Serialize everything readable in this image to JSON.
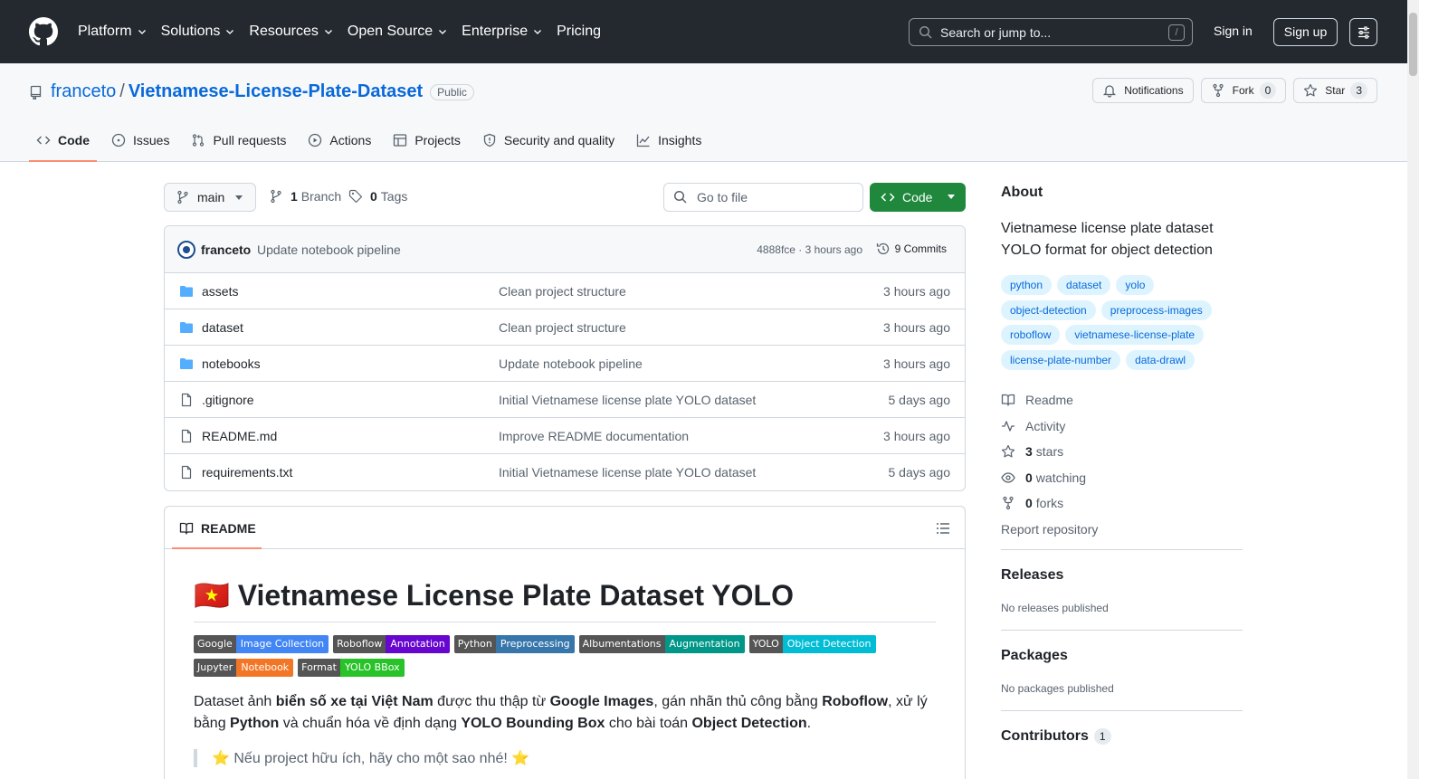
{
  "header": {
    "nav": [
      "Platform",
      "Solutions",
      "Resources",
      "Open Source",
      "Enterprise",
      "Pricing"
    ],
    "search_placeholder": "Search or jump to...",
    "search_shortcut": "/",
    "sign_in": "Sign in",
    "sign_up": "Sign up"
  },
  "repo": {
    "owner": "franceto",
    "separator": "/",
    "name": "Vietnamese-License-Plate-Dataset",
    "visibility": "Public",
    "notifications_label": "Notifications",
    "fork_label": "Fork",
    "fork_count": "0",
    "star_label": "Star",
    "star_count": "3",
    "tabs": [
      "Code",
      "Issues",
      "Pull requests",
      "Actions",
      "Projects",
      "Security and quality",
      "Insights"
    ]
  },
  "toolbar": {
    "branch": "main",
    "branches_count": "1",
    "branches_label": "Branch",
    "tags_count": "0",
    "tags_label": "Tags",
    "goto_placeholder": "Go to file",
    "code_button": "Code"
  },
  "commit": {
    "author": "franceto",
    "message": "Update notebook pipeline",
    "sha_time": "4888fce · 3 hours ago",
    "commits_label": "9 Commits"
  },
  "files": [
    {
      "name": "assets",
      "type": "folder",
      "message": "Clean project structure",
      "age": "3 hours ago"
    },
    {
      "name": "dataset",
      "type": "folder",
      "message": "Clean project structure",
      "age": "3 hours ago"
    },
    {
      "name": "notebooks",
      "type": "folder",
      "message": "Update notebook pipeline",
      "age": "3 hours ago"
    },
    {
      "name": ".gitignore",
      "type": "file",
      "message": "Initial Vietnamese license plate YOLO dataset",
      "age": "5 days ago"
    },
    {
      "name": "README.md",
      "type": "file",
      "message": "Improve README documentation",
      "age": "3 hours ago"
    },
    {
      "name": "requirements.txt",
      "type": "file",
      "message": "Initial Vietnamese license plate YOLO dataset",
      "age": "5 days ago"
    }
  ],
  "readme": {
    "tab_label": "README",
    "title": "🇻🇳 Vietnamese License Plate Dataset YOLO",
    "shields": [
      {
        "left": "Google",
        "right": "Image Collection",
        "color": "#4285f4"
      },
      {
        "left": "Roboflow",
        "right": "Annotation",
        "color": "#6706ce"
      },
      {
        "left": "Python",
        "right": "Preprocessing",
        "color": "#3776ab"
      },
      {
        "left": "Albumentations",
        "right": "Augmentation",
        "color": "#009688"
      },
      {
        "left": "YOLO",
        "right": "Object Detection",
        "color": "#00bcd4"
      },
      {
        "left": "Jupyter",
        "right": "Notebook",
        "color": "#f37626"
      },
      {
        "left": "Format",
        "right": "YOLO BBox",
        "color": "#28c328"
      }
    ],
    "p1_a": "Dataset ảnh ",
    "p1_b": "biển số xe tại Việt Nam",
    "p1_c": " được thu thập từ ",
    "p1_d": "Google Images",
    "p1_e": ", gán nhãn thủ công bằng ",
    "p1_f": "Roboflow",
    "p1_g": ", xử lý bằng ",
    "p1_h": "Python",
    "p1_i": " và chuẩn hóa về định dạng ",
    "p1_j": "YOLO Bounding Box",
    "p1_k": " cho bài toán ",
    "p1_l": "Object Detection",
    "p1_m": ".",
    "quote": "⭐ Nếu project hữu ích, hãy cho một sao nhé! ⭐"
  },
  "about": {
    "heading": "About",
    "description": "Vietnamese license plate dataset YOLO format for object detection",
    "topics": [
      "python",
      "dataset",
      "yolo",
      "object-detection",
      "preprocess-images",
      "roboflow",
      "vietnamese-license-plate",
      "license-plate-number",
      "data-drawl"
    ],
    "readme": "Readme",
    "activity": "Activity",
    "stars_count": "3",
    "stars_label": "stars",
    "watching_count": "0",
    "watching_label": "watching",
    "forks_count": "0",
    "forks_label": "forks",
    "report": "Report repository"
  },
  "releases": {
    "heading": "Releases",
    "text": "No releases published"
  },
  "packages": {
    "heading": "Packages",
    "text": "No packages published"
  },
  "contributors": {
    "heading": "Contributors",
    "count": "1"
  }
}
